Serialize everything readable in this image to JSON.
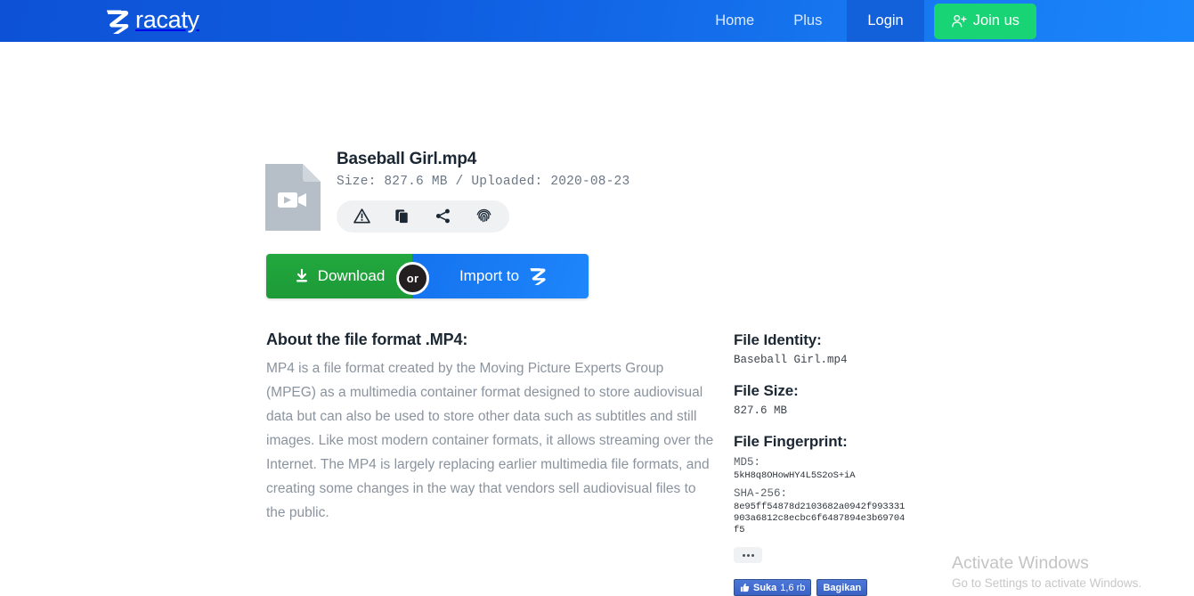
{
  "header": {
    "brand_name": "racaty",
    "brand_logo_icon": "racaty-r-logo-icon",
    "nav": [
      {
        "label": "Home",
        "name": "nav-home"
      },
      {
        "label": "Plus",
        "name": "nav-plus"
      }
    ],
    "login_label": "Login",
    "join_label": "Join us",
    "join_icon": "user-plus-icon",
    "colors": {
      "gradient_start": "#0d52d6",
      "gradient_end": "#1b86fb",
      "login_bg": "#1260da",
      "join_bg": "#18d474"
    }
  },
  "file": {
    "thumb_icon": "video-file-icon",
    "name": "Baseball Girl.mp4",
    "details": "Size: 827.6 MB / Uploaded: 2020-08-23",
    "actions": [
      {
        "name": "report-button",
        "icon": "warning-triangle-icon"
      },
      {
        "name": "copy-button",
        "icon": "copy-icon"
      },
      {
        "name": "share-button",
        "icon": "share-icon"
      },
      {
        "name": "fingerprint-button",
        "icon": "fingerprint-icon"
      }
    ]
  },
  "buttons": {
    "download_label": "Download",
    "download_icon": "download-icon",
    "or_label": "or",
    "import_label": "Import to",
    "import_icon": "racaty-r-logo-icon",
    "download_color": "#22a83e",
    "import_color": "#1473ef"
  },
  "about": {
    "title": "About the file format .MP4:",
    "body": "MP4 is a file format created by the Moving Picture Experts Group (MPEG) as a multimedia container format designed to store audiovisual data but can also be used to store other data such as subtitles and still images. Like most modern container formats, it allows streaming over the Internet. The MP4 is largely replacing earlier multimedia file formats, and creating some changes in the way that vendors sell audiovisual files to the public."
  },
  "sidebar": {
    "identity_heading": "File Identity:",
    "identity_value": "Baseball Girl.mp4",
    "size_heading": "File Size:",
    "size_value": "827.6 MB",
    "fingerprint_heading": "File Fingerprint:",
    "md5_label": "MD5:",
    "md5_value": "5kH8q8OHowHY4L5S2oS+iA",
    "sha_label": "SHA-256:",
    "sha_value": "8e95ff54878d2103682a0942f993331903a6812c8ecbc6f6487894e3b69704f5",
    "more_icon": "ellipsis-icon"
  },
  "facebook": {
    "like_label": "Suka",
    "like_count": "1,6 rb",
    "share_label": "Bagikan",
    "thumb_icon": "thumbs-up-icon"
  },
  "watermark": {
    "title": "Activate Windows",
    "subtitle": "Go to Settings to activate Windows."
  }
}
